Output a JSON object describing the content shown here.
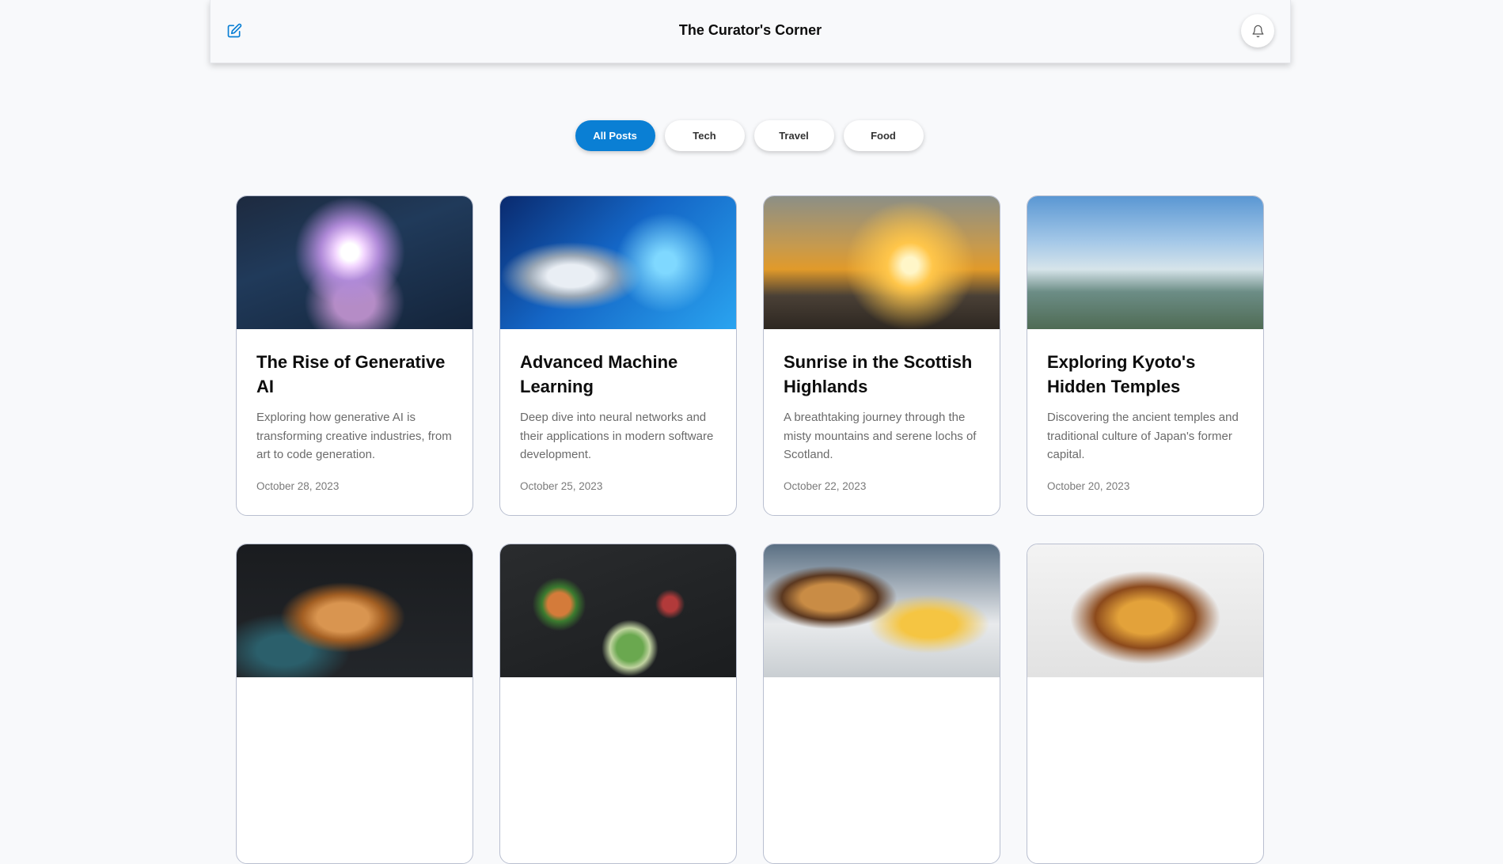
{
  "header": {
    "title": "The Curator's Corner",
    "edit_icon": "edit-icon",
    "bell_icon": "bell-icon"
  },
  "filters": [
    {
      "label": "All Posts",
      "active": true
    },
    {
      "label": "Tech",
      "active": false
    },
    {
      "label": "Travel",
      "active": false
    },
    {
      "label": "Food",
      "active": false
    }
  ],
  "colors": {
    "accent": "#0a7fd4",
    "background": "#f8f9fb",
    "card_border": "#b9bfd0"
  },
  "posts": [
    {
      "title": "The Rise of Generative AI",
      "description": "Exploring how generative AI is transforming creative industries, from art to code generation.",
      "date": "October 28, 2023"
    },
    {
      "title": "Advanced Machine Learning",
      "description": "Deep dive into neural networks and their applications in modern software development.",
      "date": "October 25, 2023"
    },
    {
      "title": "Sunrise in the Scottish Highlands",
      "description": "A breathtaking journey through the misty mountains and serene lochs of Scotland.",
      "date": "October 22, 2023"
    },
    {
      "title": "Exploring Kyoto's Hidden Temples",
      "description": "Discovering the ancient temples and traditional culture of Japan's former capital.",
      "date": "October 20, 2023"
    }
  ]
}
